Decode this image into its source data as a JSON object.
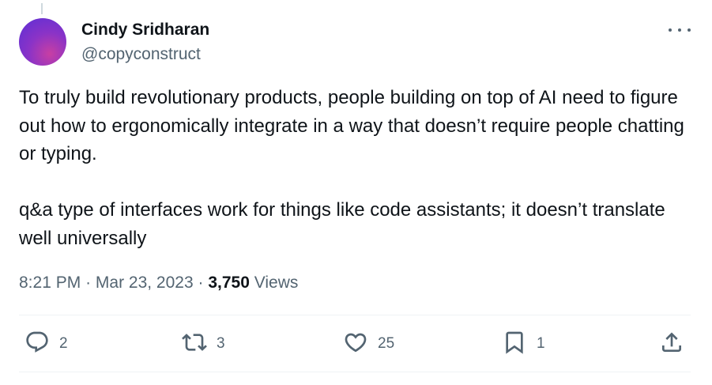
{
  "author": {
    "display_name": "Cindy Sridharan",
    "handle": "@copyconstruct"
  },
  "tweet": {
    "paragraphs": [
      "To truly build revolutionary products, people building on top of AI need to figure out how to ergonomically integrate in a way that doesn’t require people chatting or typing.",
      "q&a type of interfaces work for things like code assistants; it doesn’t translate well universally"
    ],
    "time": "8:21 PM",
    "separator": "·",
    "date": "Mar 23, 2023",
    "views_count": "3,750",
    "views_label": "Views"
  },
  "actions": {
    "replies": "2",
    "retweets": "3",
    "likes": "25",
    "bookmarks": "1"
  },
  "icons": {
    "reply": "reply-icon",
    "retweet": "retweet-icon",
    "like": "heart-icon",
    "bookmark": "bookmark-icon",
    "share": "share-icon",
    "more": "more-icon"
  },
  "colors": {
    "text_primary": "#0f1419",
    "text_secondary": "#536471",
    "divider": "#eff3f4"
  }
}
